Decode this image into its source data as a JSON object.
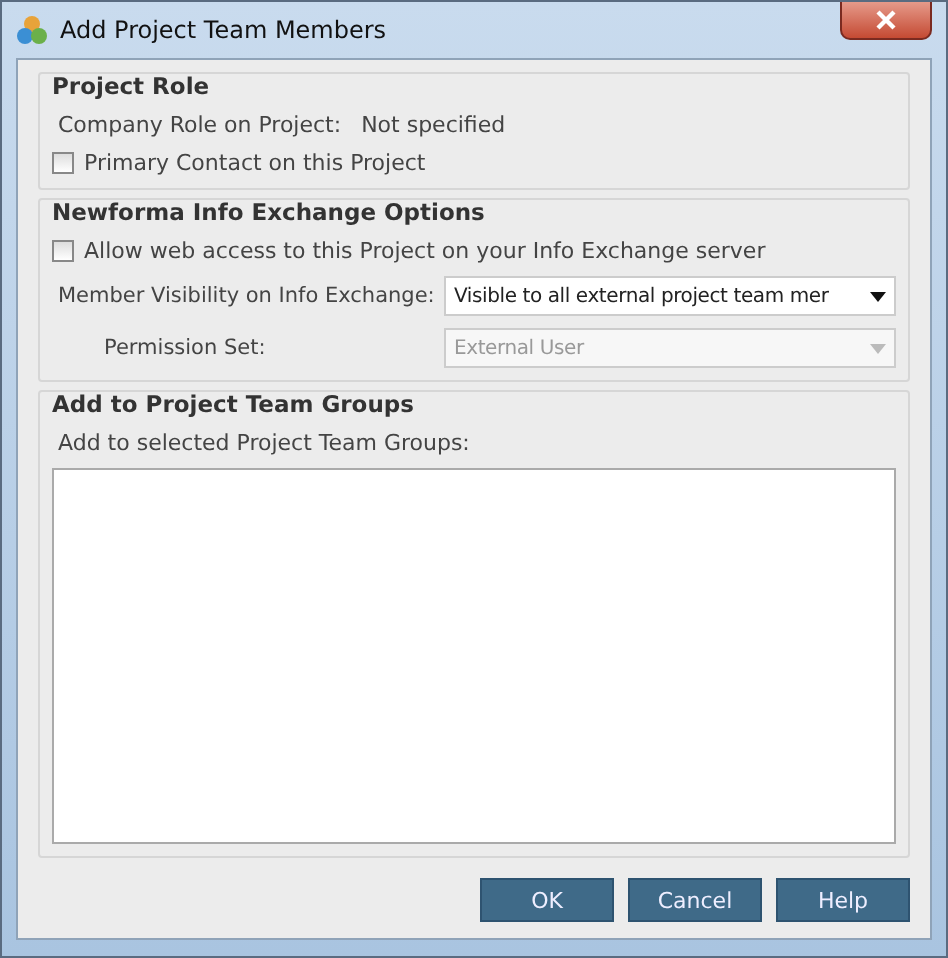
{
  "window": {
    "title": "Add Project Team Members"
  },
  "project_role": {
    "heading": "Project Role",
    "company_role_label": "Company Role on Project:",
    "company_role_value": "Not specified",
    "primary_contact": {
      "label": "Primary Contact on this Project",
      "checked": false
    }
  },
  "info_exchange": {
    "heading": "Newforma Info Exchange Options",
    "web_access": {
      "label": "Allow web access to this Project on your Info Exchange server",
      "checked": false
    },
    "fields": [
      {
        "label": "Member Visibility on Info Exchange:",
        "value": "Visible to all external project team mer",
        "disabled": false
      },
      {
        "label": "Permission Set:",
        "value": "External User",
        "disabled": true
      }
    ]
  },
  "team_groups": {
    "heading": "Add to Project Team Groups",
    "label": "Add to selected Project Team Groups:"
  },
  "buttons": [
    "OK",
    "Cancel",
    "Help"
  ]
}
